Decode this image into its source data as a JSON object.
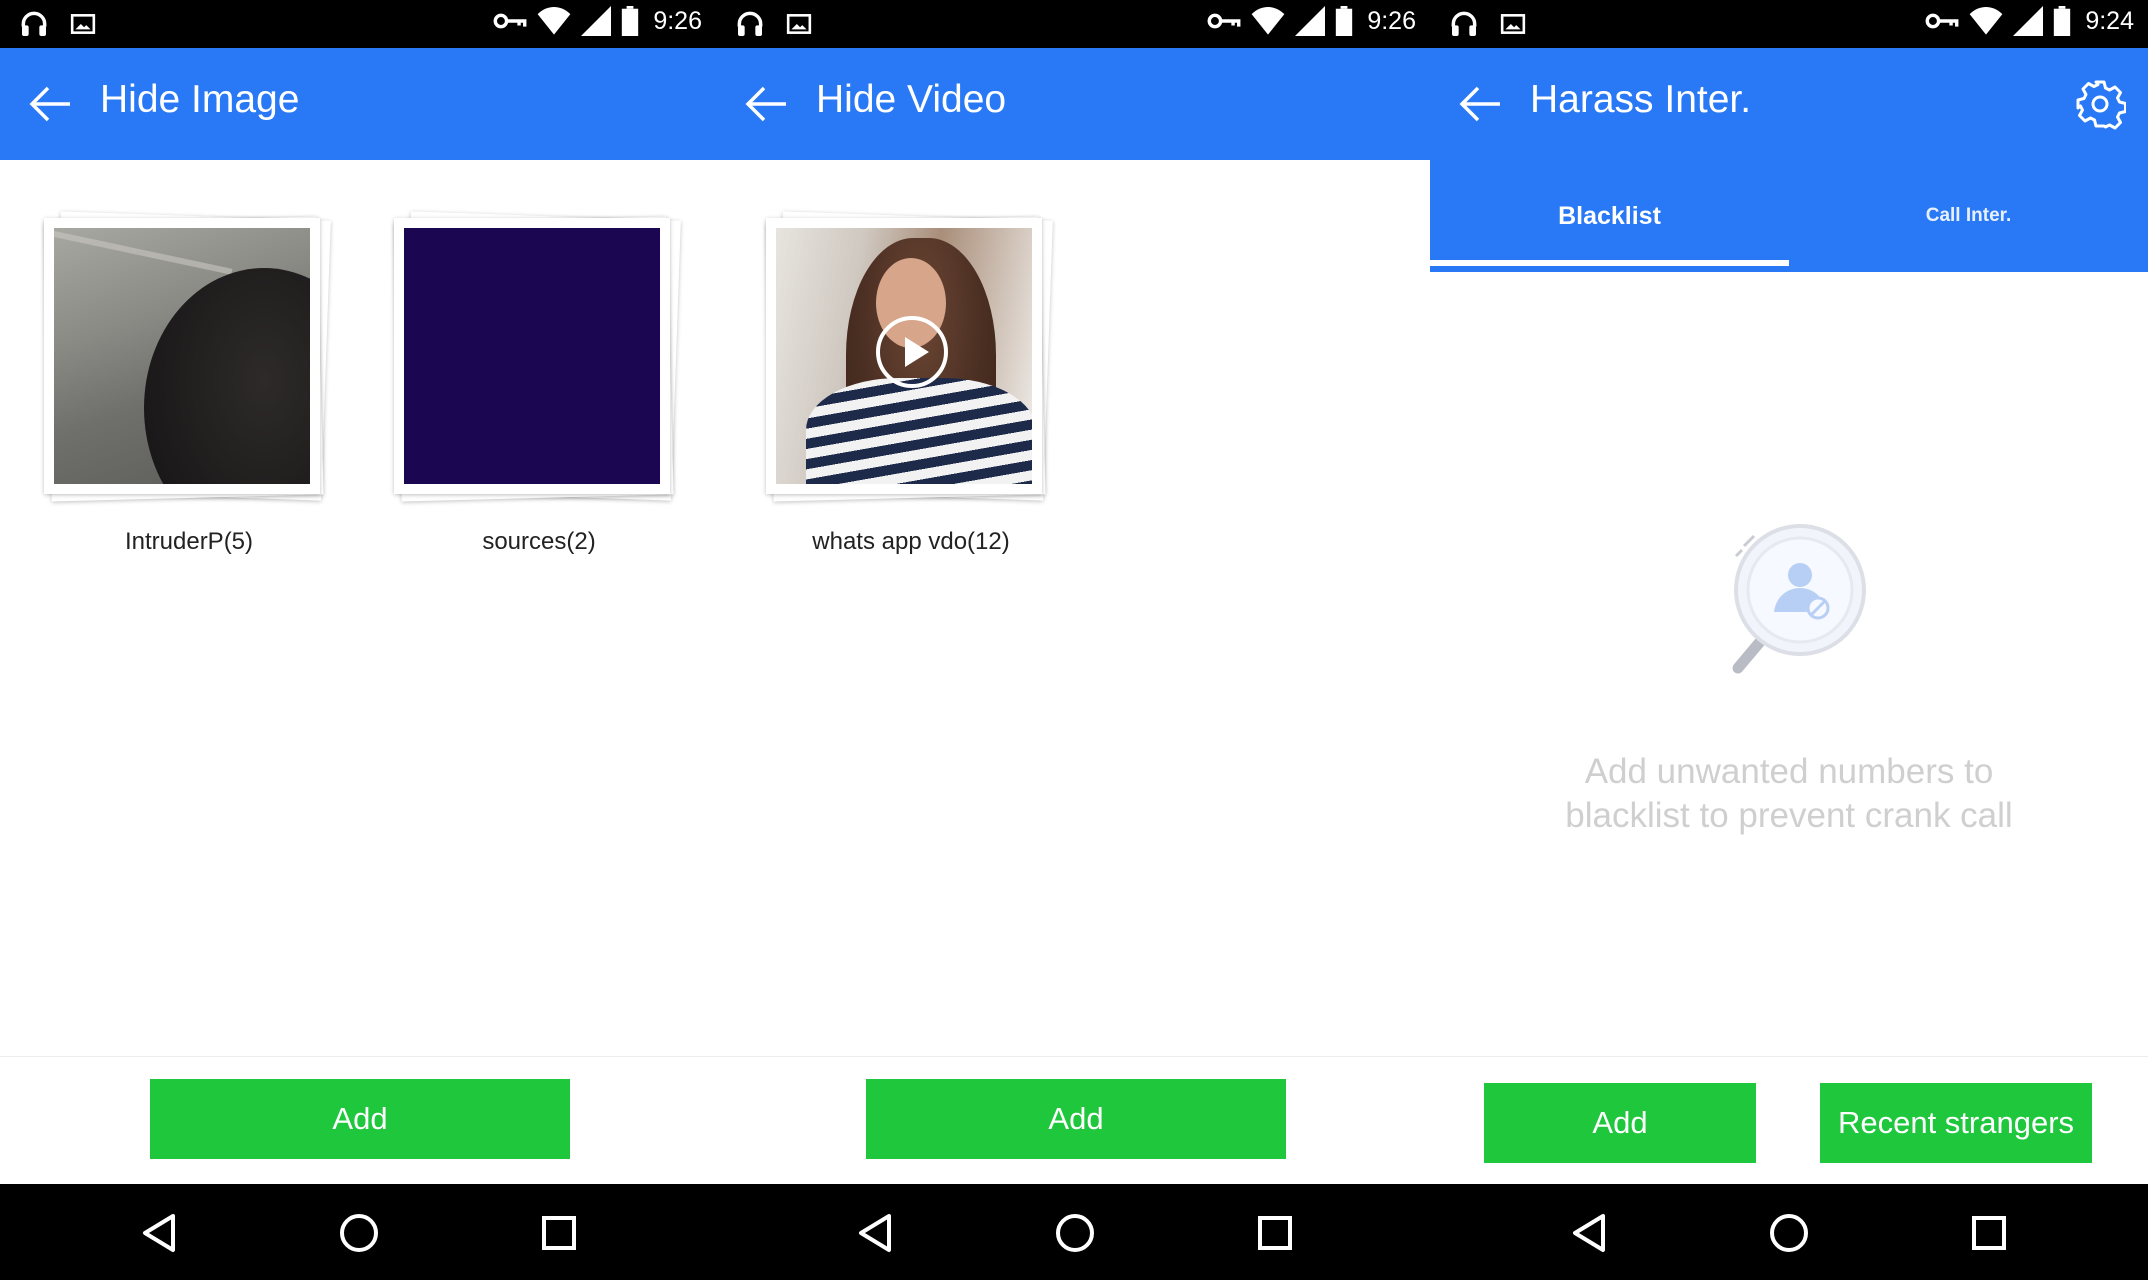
{
  "screens": [
    {
      "status_time": "9:26",
      "title": "Hide Image",
      "albums": [
        {
          "name": "IntruderP(5)"
        },
        {
          "name": "sources(2)"
        }
      ],
      "add_label": "Add"
    },
    {
      "status_time": "9:26",
      "title": "Hide Video",
      "albums": [
        {
          "name": "whats app vdo(12)"
        }
      ],
      "add_label": "Add"
    },
    {
      "status_time": "9:24",
      "title": "Harass Inter.",
      "tabs": [
        {
          "label": "Blacklist",
          "selected": true
        },
        {
          "label": "Call Inter.",
          "selected": false
        }
      ],
      "empty_message_line1": "Add unwanted numbers to",
      "empty_message_line2": "blacklist to prevent crank call",
      "add_label": "Add",
      "recent_label": "Recent strangers"
    }
  ],
  "icons": {
    "status_left": [
      "headphones-icon",
      "image-icon"
    ],
    "status_right": [
      "vpn-key-icon",
      "wifi-icon",
      "signal-icon",
      "battery-icon"
    ],
    "nav": [
      "back-triangle-icon",
      "home-circle-icon",
      "recents-square-icon"
    ]
  },
  "colors": {
    "app_bar": "#2979f6",
    "button": "#1ec73c",
    "empty_text": "#cfcfcf"
  }
}
